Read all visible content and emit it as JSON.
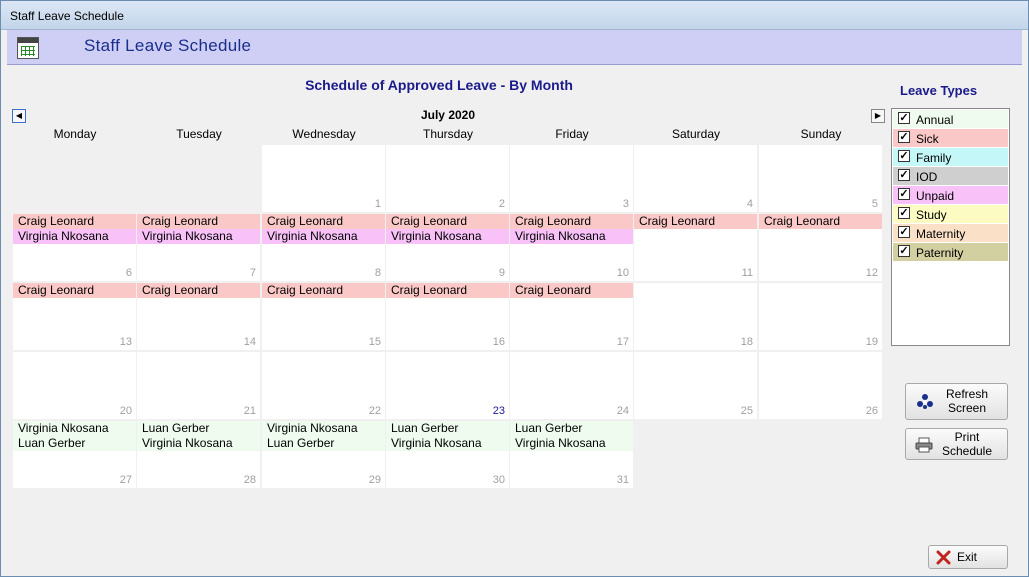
{
  "window": {
    "title": "Staff Leave Schedule"
  },
  "header": {
    "title": "Staff Leave Schedule",
    "icon": "calendar-icon"
  },
  "schedule": {
    "title": "Schedule of Approved Leave - By Month",
    "month_label": "July 2020",
    "nav_prev_glyph": "◀",
    "nav_next_glyph": "▶",
    "day_headers": [
      "Monday",
      "Tuesday",
      "Wednesday",
      "Thursday",
      "Friday",
      "Saturday",
      "Sunday"
    ],
    "weeks": [
      [
        {
          "day": ""
        },
        {
          "day": ""
        },
        {
          "day": "1"
        },
        {
          "day": "2"
        },
        {
          "day": "3"
        },
        {
          "day": "4"
        },
        {
          "day": "5"
        }
      ],
      [
        {
          "day": "6",
          "entries": [
            {
              "name": "Craig Leonard",
              "type": "sick"
            },
            {
              "name": "Virginia Nkosana",
              "type": "unpaid"
            }
          ]
        },
        {
          "day": "7",
          "entries": [
            {
              "name": "Craig Leonard",
              "type": "sick"
            },
            {
              "name": "Virginia Nkosana",
              "type": "unpaid"
            }
          ]
        },
        {
          "day": "8",
          "entries": [
            {
              "name": "Craig Leonard",
              "type": "sick"
            },
            {
              "name": "Virginia Nkosana",
              "type": "unpaid"
            }
          ]
        },
        {
          "day": "9",
          "entries": [
            {
              "name": "Craig Leonard",
              "type": "sick"
            },
            {
              "name": "Virginia Nkosana",
              "type": "unpaid"
            }
          ]
        },
        {
          "day": "10",
          "entries": [
            {
              "name": "Craig Leonard",
              "type": "sick"
            },
            {
              "name": "Virginia Nkosana",
              "type": "unpaid"
            }
          ]
        },
        {
          "day": "11",
          "entries": [
            {
              "name": "Craig Leonard",
              "type": "sick"
            }
          ]
        },
        {
          "day": "12",
          "entries": [
            {
              "name": "Craig Leonard",
              "type": "sick"
            }
          ]
        }
      ],
      [
        {
          "day": "13",
          "entries": [
            {
              "name": "Craig Leonard",
              "type": "sick"
            }
          ]
        },
        {
          "day": "14",
          "entries": [
            {
              "name": "Craig Leonard",
              "type": "sick"
            }
          ]
        },
        {
          "day": "15",
          "entries": [
            {
              "name": "Craig Leonard",
              "type": "sick"
            }
          ]
        },
        {
          "day": "16",
          "entries": [
            {
              "name": "Craig Leonard",
              "type": "sick"
            }
          ]
        },
        {
          "day": "17",
          "entries": [
            {
              "name": "Craig Leonard",
              "type": "sick"
            }
          ]
        },
        {
          "day": "18"
        },
        {
          "day": "19"
        }
      ],
      [
        {
          "day": "20"
        },
        {
          "day": "21"
        },
        {
          "day": "22"
        },
        {
          "day": "23",
          "today": true
        },
        {
          "day": "24"
        },
        {
          "day": "25"
        },
        {
          "day": "26"
        }
      ],
      [
        {
          "day": "27",
          "entries": [
            {
              "name": "Virginia Nkosana",
              "type": "annual"
            },
            {
              "name": "Luan Gerber",
              "type": "annual"
            }
          ]
        },
        {
          "day": "28",
          "entries": [
            {
              "name": "Luan Gerber",
              "type": "annual"
            },
            {
              "name": "Virginia Nkosana",
              "type": "annual"
            }
          ]
        },
        {
          "day": "29",
          "entries": [
            {
              "name": "Virginia Nkosana",
              "type": "annual"
            },
            {
              "name": "Luan Gerber",
              "type": "annual"
            }
          ]
        },
        {
          "day": "30",
          "entries": [
            {
              "name": "Luan Gerber",
              "type": "annual"
            },
            {
              "name": "Virginia Nkosana",
              "type": "annual"
            }
          ]
        },
        {
          "day": "31",
          "entries": [
            {
              "name": "Luan Gerber",
              "type": "annual"
            },
            {
              "name": "Virginia Nkosana",
              "type": "annual"
            }
          ]
        },
        null,
        null
      ]
    ]
  },
  "leave_types": {
    "title": "Leave Types",
    "items": [
      {
        "label": "Annual",
        "color": "#eefbee",
        "checked": true
      },
      {
        "label": "Sick",
        "color": "#fbc8c8",
        "checked": true
      },
      {
        "label": "Family",
        "color": "#c4f7f7",
        "checked": true
      },
      {
        "label": "IOD",
        "color": "#cfcfcf",
        "checked": true
      },
      {
        "label": "Unpaid",
        "color": "#f8c2f8",
        "checked": true
      },
      {
        "label": "Study",
        "color": "#fbfbc2",
        "checked": true
      },
      {
        "label": "Maternity",
        "color": "#fbe0c8",
        "checked": true
      },
      {
        "label": "Paternity",
        "color": "#d2cfa0",
        "checked": true
      }
    ]
  },
  "buttons": {
    "refresh": "Refresh\nScreen",
    "print": "Print\nSchedule",
    "exit": "Exit"
  }
}
